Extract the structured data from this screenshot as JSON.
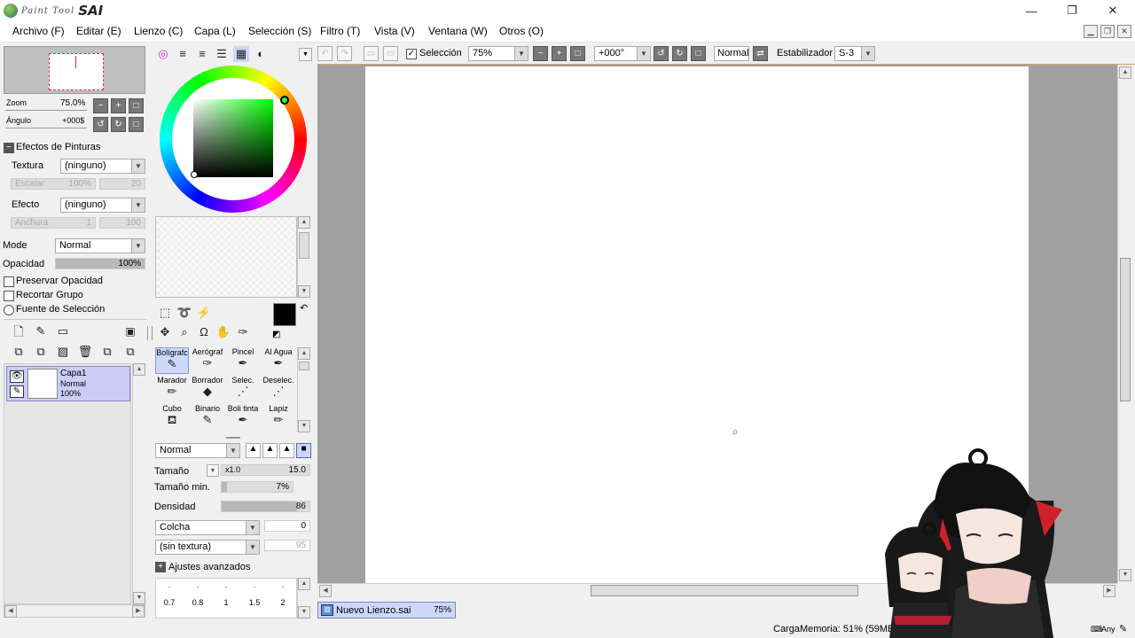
{
  "app": {
    "logo_small": "Paint Tool",
    "logo_big": "SAI"
  },
  "window": {
    "minimize": "—",
    "maximize": "❐",
    "close": "✕"
  },
  "menu": [
    "Archivo (F)",
    "Editar (E)",
    "Lienzo (C)",
    "Capa (L)",
    "Selección (S)",
    "Filtro (T)",
    "Vista (V)",
    "Ventana (W)",
    "Otros (O)"
  ],
  "navigator": {
    "zoom_label": "Zoom",
    "zoom_value": "75.0%",
    "angle_label": "Ángulo",
    "angle_value": "+000$"
  },
  "paint_effects": {
    "header": "Efectos de Pinturas",
    "texture_label": "Textura",
    "texture_value": "(ninguno)",
    "scale_label": "Escalar",
    "scale_value": "100%",
    "scale_num": "20",
    "effect_label": "Efecto",
    "effect_value": "(ninguno)",
    "width_label": "Anchura",
    "width_value": "1",
    "width_num": "100"
  },
  "layer_props": {
    "mode_label": "Mode",
    "mode_value": "Normal",
    "opacity_label": "Opacidad",
    "opacity_value": "100%",
    "opacity_fraction": 1.0,
    "preserve_opacity": "Preservar Opacidad",
    "clip_group": "Recortar Grupo",
    "selection_source": "Fuente de Selección"
  },
  "layers": [
    {
      "name": "Capa1",
      "mode": "Normal",
      "opacity": "100%"
    }
  ],
  "toolbar": {
    "selection_label": "Selección",
    "zoom_value": "75%",
    "angle_value": "+000°",
    "blend_value": "Normal",
    "stabilizer_label": "Estabilizador",
    "stabilizer_value": "S-3"
  },
  "tools": [
    {
      "label": "Bolígrafc",
      "icon": "pen-icon",
      "glyph": "✎",
      "selected": true
    },
    {
      "label": "Aerógraf",
      "icon": "airbrush-icon",
      "glyph": "✑",
      "selected": false
    },
    {
      "label": "Pincel",
      "icon": "brush-icon",
      "glyph": "✒",
      "selected": false
    },
    {
      "label": "Al Agua",
      "icon": "watercolor-icon",
      "glyph": "✒",
      "selected": false
    },
    {
      "label": "Marador",
      "icon": "marker-icon",
      "glyph": "✏",
      "selected": false
    },
    {
      "label": "Borrador",
      "icon": "eraser-icon",
      "glyph": "◆",
      "selected": false
    },
    {
      "label": "Selec.",
      "icon": "select-pen-icon",
      "glyph": "⋰",
      "selected": false
    },
    {
      "label": "Deselec.",
      "icon": "deselect-pen-icon",
      "glyph": "⋰",
      "selected": false
    },
    {
      "label": "Cubo",
      "icon": "bucket-icon",
      "glyph": "⛾",
      "selected": false
    },
    {
      "label": "Binario",
      "icon": "binary-pen-icon",
      "glyph": "✎",
      "selected": false
    },
    {
      "label": "Boli tinta",
      "icon": "ink-pen-icon",
      "glyph": "✒",
      "selected": false
    },
    {
      "label": "Lapiz",
      "icon": "pencil-icon",
      "glyph": "✏",
      "selected": false
    }
  ],
  "brush": {
    "blend_value": "Normal",
    "size_label": "Tamaño",
    "size_mult": "x1.0",
    "size_value": "15.0",
    "min_size_label": "Tamaño min.",
    "min_size_value": "7%",
    "min_size_fraction": 0.07,
    "density_label": "Densidad",
    "density_value": "86",
    "density_fraction": 0.86,
    "shape_value": "Colcha",
    "shape_num": "0",
    "texture_value": "(sin textura)",
    "texture_num": "95",
    "advanced_label": "Ajustes avanzados",
    "size_presets": [
      "0.7",
      "0.8",
      "1",
      "1.5",
      "2"
    ]
  },
  "document_tab": {
    "name": "Nuevo Lienzo.sai",
    "zoom": "75%"
  },
  "status": {
    "memory": "CargaMemoria: 51% (59MB usa",
    "any": "Any"
  }
}
